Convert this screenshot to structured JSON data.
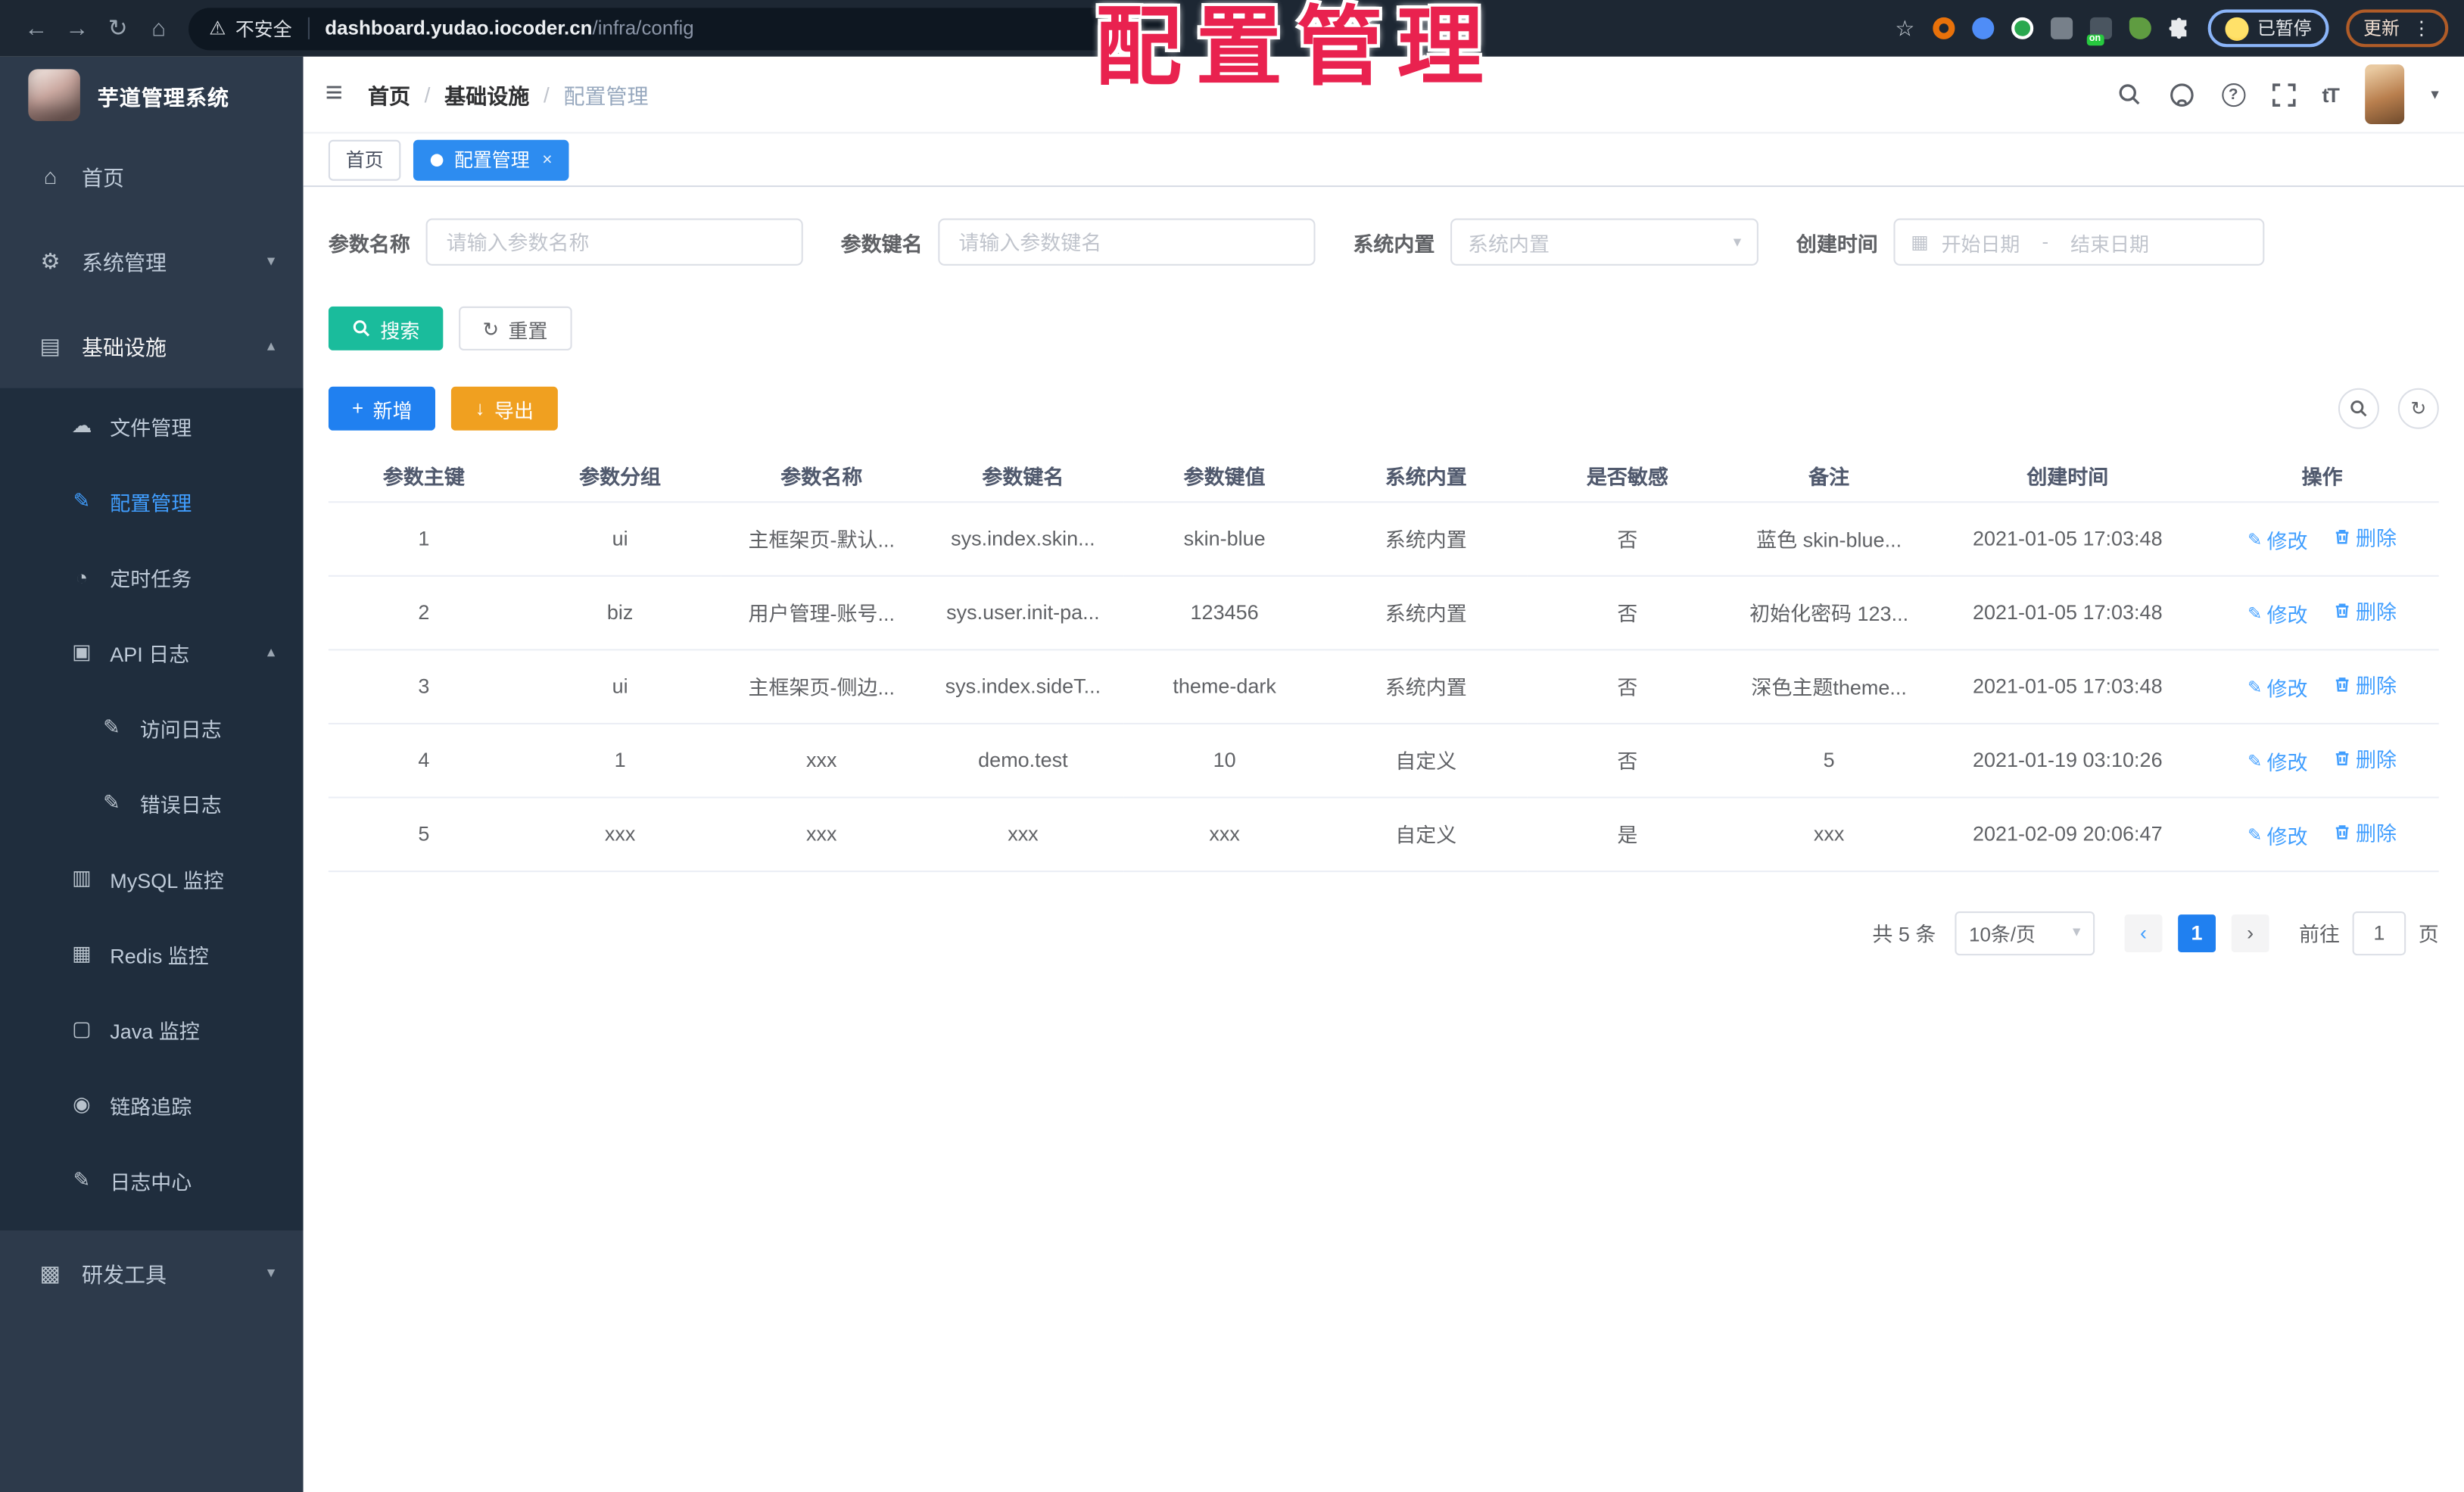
{
  "browser": {
    "security_label": "不安全",
    "url_host": "dashboard.yudao.iocoder.cn",
    "url_path": "/infra/config",
    "paused_badge": "已暂停",
    "update_badge": "更新"
  },
  "overlay_title": "配置管理",
  "icons": {
    "back": "←",
    "forward": "→",
    "reload": "↻",
    "home": "⌂",
    "warning": "⚠",
    "star": "☆",
    "more_vert": "⋮",
    "hamburger": "≡",
    "caret_down": "▾",
    "chevron_up": "▴",
    "chevron_down": "▾",
    "refresh": "↻",
    "plus": "+",
    "download": "↓",
    "calendar": "▦",
    "edit": "✎",
    "help": "?",
    "font_size": "tT",
    "menu_home": "⌂",
    "menu_system": "⚙",
    "menu_infra": "▤",
    "menu_file": "☁",
    "menu_config": "✎",
    "menu_job": "◔",
    "menu_api_log": "▣",
    "menu_access_log": "✎",
    "menu_error_log": "✎",
    "menu_mysql": "▥",
    "menu_redis": "▦",
    "menu_java": "▢",
    "menu_trace": "◉",
    "menu_log_center": "✎",
    "menu_dev_tools": "▩"
  },
  "sidebar": {
    "app_title": "芋道管理系统",
    "menu": {
      "home": "首页",
      "system": "系统管理",
      "infra": "基础设施",
      "file": "文件管理",
      "config": "配置管理",
      "job": "定时任务",
      "api_log": "API 日志",
      "access_log": "访问日志",
      "error_log": "错误日志",
      "mysql": "MySQL 监控",
      "redis": "Redis 监控",
      "java": "Java 监控",
      "trace": "链路追踪",
      "log_center": "日志中心",
      "dev_tools": "研发工具"
    }
  },
  "header": {
    "separator": "/",
    "breadcrumb": [
      "首页",
      "基础设施",
      "配置管理"
    ]
  },
  "tabs": {
    "home": "首页",
    "active": "配置管理"
  },
  "filters": {
    "name_label": "参数名称",
    "name_placeholder": "请输入参数名称",
    "key_label": "参数键名",
    "key_placeholder": "请输入参数键名",
    "type_label": "系统内置",
    "type_placeholder": "系统内置",
    "time_label": "创建时间",
    "start_placeholder": "开始日期",
    "range_separator": "-",
    "end_placeholder": "结束日期"
  },
  "actions": {
    "search": "搜索",
    "reset": "重置",
    "add": "新增",
    "export": "导出"
  },
  "table": {
    "headers": [
      "参数主键",
      "参数分组",
      "参数名称",
      "参数键名",
      "参数键值",
      "系统内置",
      "是否敏感",
      "备注",
      "创建时间",
      "操作"
    ],
    "edit_label": "修改",
    "delete_label": "删除",
    "rows": [
      {
        "id": "1",
        "group": "ui",
        "name": "主框架页-默认...",
        "key": "sys.index.skin...",
        "value": "skin-blue",
        "type": "系统内置",
        "sensitive": "否",
        "remark": "蓝色 skin-blue...",
        "created": "2021-01-05 17:03:48"
      },
      {
        "id": "2",
        "group": "biz",
        "name": "用户管理-账号...",
        "key": "sys.user.init-pa...",
        "value": "123456",
        "type": "系统内置",
        "sensitive": "否",
        "remark": "初始化密码 123...",
        "created": "2021-01-05 17:03:48"
      },
      {
        "id": "3",
        "group": "ui",
        "name": "主框架页-侧边...",
        "key": "sys.index.sideT...",
        "value": "theme-dark",
        "type": "系统内置",
        "sensitive": "否",
        "remark": "深色主题theme...",
        "created": "2021-01-05 17:03:48"
      },
      {
        "id": "4",
        "group": "1",
        "name": "xxx",
        "key": "demo.test",
        "value": "10",
        "type": "自定义",
        "sensitive": "否",
        "remark": "5",
        "created": "2021-01-19 03:10:26"
      },
      {
        "id": "5",
        "group": "xxx",
        "name": "xxx",
        "key": "xxx",
        "value": "xxx",
        "type": "自定义",
        "sensitive": "是",
        "remark": "xxx",
        "created": "2021-02-09 20:06:47"
      }
    ]
  },
  "pagination": {
    "total": "共 5 条",
    "page_size": "10条/页",
    "prev": "‹",
    "page": "1",
    "next": "›",
    "goto_label": "前往",
    "goto_value": "1",
    "page_unit": "页"
  },
  "colors": {
    "primary": "#2080f0",
    "tab_active": "#2d8cf0",
    "success": "#1abc9c",
    "warning": "#f0a020",
    "link": "#409eff",
    "sidebar_bg": "#2d3a4b",
    "submenu_bg": "#1f2d3d",
    "chrome_bg": "#1d2733",
    "overlay_red": "#e9224f"
  }
}
